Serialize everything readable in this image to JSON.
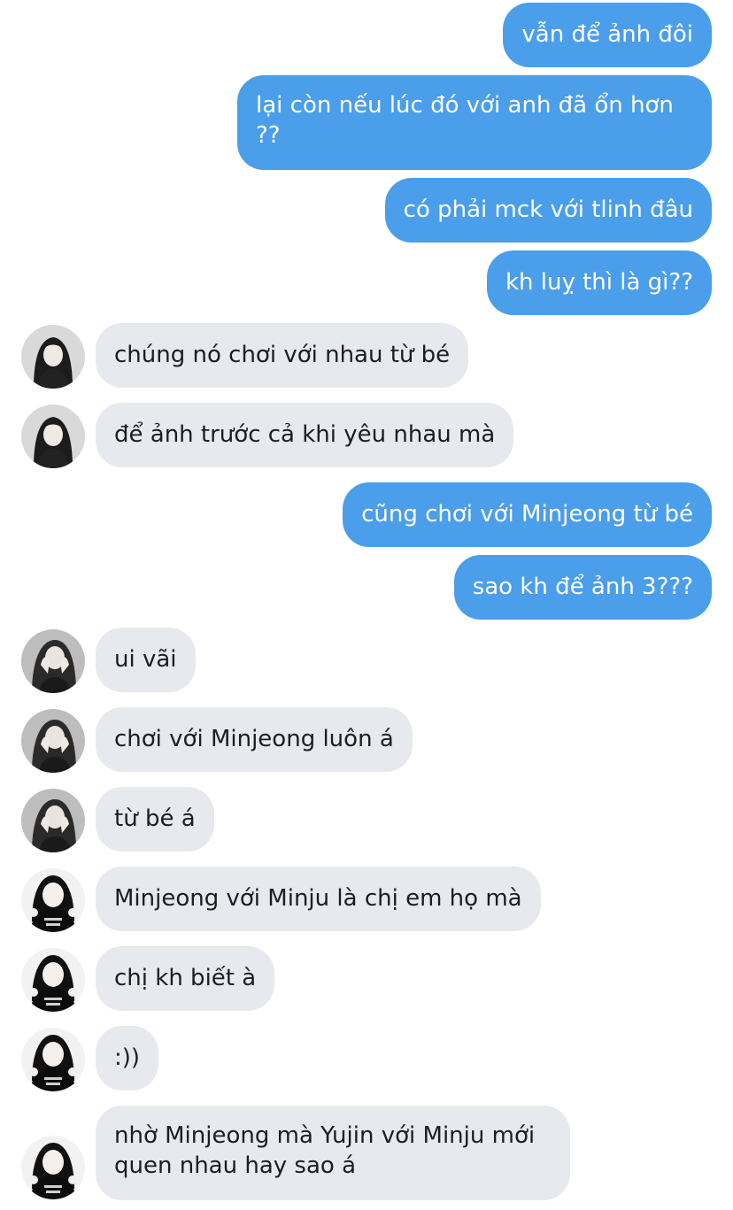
{
  "messages": [
    {
      "dir": "out",
      "text": "vẫn để ảnh đôi"
    },
    {
      "dir": "out",
      "text": "lại còn nếu lúc đó với anh đã ổn hơn ??"
    },
    {
      "dir": "out",
      "text": "có phải mck với tlinh đâu"
    },
    {
      "dir": "out",
      "text": "kh luỵ thì là gì??"
    },
    {
      "dir": "in",
      "text": "chúng nó chơi với nhau từ bé",
      "avatar": "avatar-a"
    },
    {
      "dir": "in",
      "text": "để ảnh trước cả khi yêu nhau mà",
      "avatar": "avatar-a"
    },
    {
      "dir": "out",
      "text": "cũng chơi với Minjeong từ bé"
    },
    {
      "dir": "out",
      "text": "sao kh để ảnh 3???"
    },
    {
      "dir": "in",
      "text": "ui vãi",
      "avatar": "avatar-b"
    },
    {
      "dir": "in",
      "text": "chơi với Minjeong luôn á",
      "avatar": "avatar-b"
    },
    {
      "dir": "in",
      "text": "từ bé á",
      "avatar": "avatar-b"
    },
    {
      "dir": "in",
      "text": "Minjeong với Minju là chị em họ mà",
      "avatar": "avatar-c"
    },
    {
      "dir": "in",
      "text": "chị kh biết à",
      "avatar": "avatar-c"
    },
    {
      "dir": "in",
      "text": ":))",
      "avatar": "avatar-c"
    },
    {
      "dir": "in",
      "text": "nhờ Minjeong mà Yujin với Minju mới quen nhau hay sao á",
      "avatar": "avatar-c"
    }
  ],
  "colors": {
    "outgoing_bubble": "#4a9eea",
    "incoming_bubble": "#e7e9ee"
  }
}
